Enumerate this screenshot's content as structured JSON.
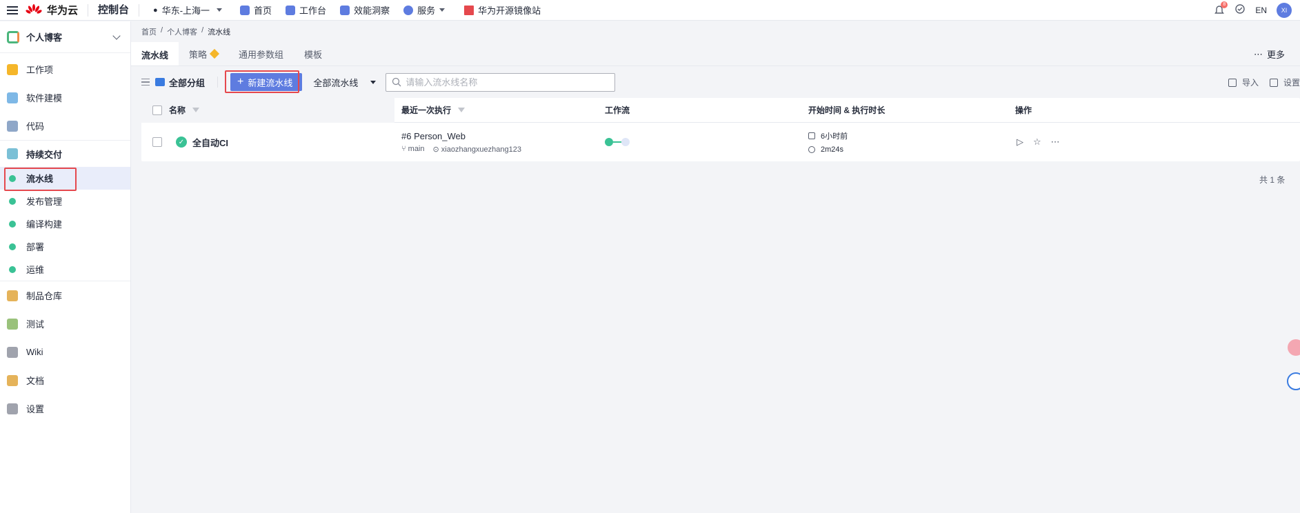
{
  "topbar": {
    "brand": "华为云",
    "console": "控制台",
    "region": "华东-上海一",
    "nav": [
      {
        "label": "首页",
        "icon": "home-icon",
        "color": "#5e7ce0"
      },
      {
        "label": "工作台",
        "icon": "workbench-icon",
        "color": "#5e7ce0"
      },
      {
        "label": "效能洞察",
        "icon": "insight-icon",
        "color": "#5e7ce0"
      },
      {
        "label": "服务",
        "icon": "service-icon",
        "color": "#5e7ce0"
      },
      {
        "label": "华为开源镜像站",
        "icon": "mirror-icon",
        "color": "#e5484d"
      }
    ],
    "bell_count": "8",
    "lang": "EN",
    "avatar": "XI"
  },
  "sidebar": {
    "project": "个人博客",
    "items": [
      {
        "label": "工作项",
        "color": "#f5b62a"
      },
      {
        "label": "软件建模",
        "color": "#7eb8e6"
      },
      {
        "label": "代码",
        "color": "#8fa7c8"
      },
      {
        "label": "持续交付",
        "color": "#7bc0d6"
      },
      {
        "label": "流水线",
        "color": "#3ac295"
      },
      {
        "label": "发布管理",
        "color": "#3ac295"
      },
      {
        "label": "编译构建",
        "color": "#3ac295"
      },
      {
        "label": "部署",
        "color": "#3ac295"
      },
      {
        "label": "运维",
        "color": "#3ac295"
      },
      {
        "label": "制品仓库",
        "color": "#e5b35a"
      },
      {
        "label": "测试",
        "color": "#9ac27b"
      },
      {
        "label": "Wiki",
        "color": "#a0a3ad"
      },
      {
        "label": "文档",
        "color": "#e5b35a"
      },
      {
        "label": "设置",
        "color": "#a0a3ad"
      }
    ]
  },
  "breadcrumb": [
    "首页",
    "个人博客",
    "流水线"
  ],
  "tabs": [
    "流水线",
    "策略",
    "通用参数组",
    "模板"
  ],
  "more": "更多",
  "toolbar": {
    "group": "全部分组",
    "new_button": "新建流水线",
    "filter": "全部流水线",
    "search_placeholder": "请输入流水线名称",
    "import": "导入",
    "settings": "设置"
  },
  "table": {
    "headers": [
      "名称",
      "最近一次执行",
      "工作流",
      "开始时间 & 执行时长",
      "操作"
    ],
    "rows": [
      {
        "name": "全自动CI",
        "run": "#6 Person_Web",
        "branch": "main",
        "user": "xiaozhangxuezhang123",
        "start": "6小时前",
        "duration": "2m24s"
      }
    ]
  },
  "total": "共 1 条"
}
